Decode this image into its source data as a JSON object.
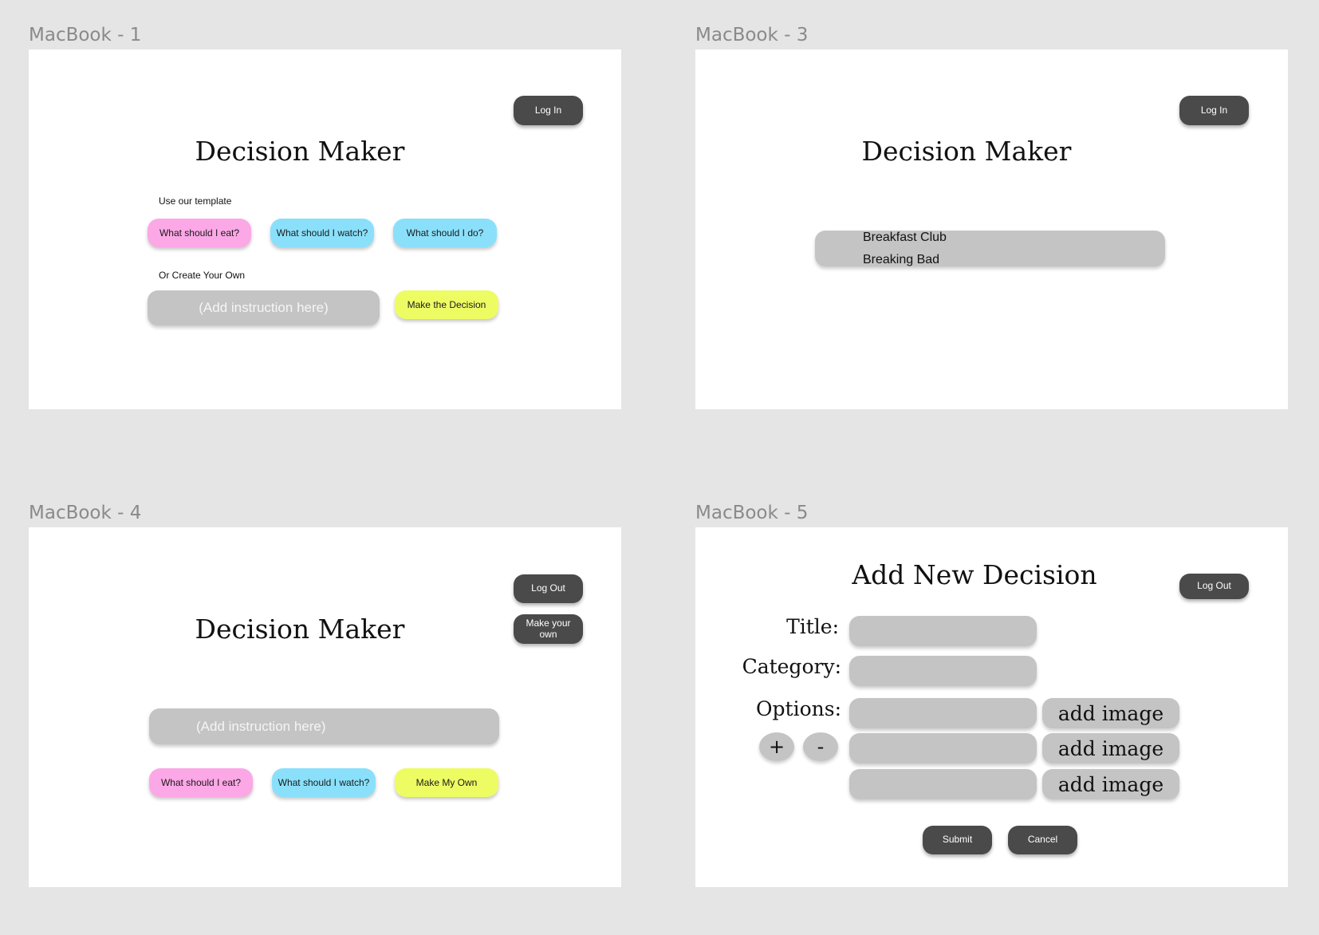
{
  "frames": {
    "f1": {
      "label": "MacBook - 1",
      "login": "Log In",
      "title": "Decision Maker",
      "template_label": "Use our template",
      "templates": [
        "What should I eat?",
        "What should I watch?",
        "What should I do?"
      ],
      "own_label": "Or Create Your Own",
      "instruction_placeholder": "(Add instruction here)",
      "make_decision": "Make the Decision"
    },
    "f3": {
      "label": "MacBook - 3",
      "login": "Log In",
      "title": "Decision Maker",
      "results": [
        "Breakfast Club",
        "Breaking Bad"
      ]
    },
    "f4": {
      "label": "MacBook - 4",
      "logout": "Log Out",
      "make_your_own": "Make your own",
      "title": "Decision Maker",
      "instruction_placeholder": "(Add instruction here)",
      "buttons": [
        "What should I eat?",
        "What should I watch?",
        "Make My Own"
      ]
    },
    "f5": {
      "label": "MacBook - 5",
      "title": "Add New Decision",
      "logout": "Log Out",
      "title_label": "Title:",
      "category_label": "Category:",
      "options_label": "Options:",
      "plus": "+",
      "minus": "-",
      "add_image": "add image",
      "submit": "Submit",
      "cancel": "Cancel"
    }
  },
  "colors": {
    "canvas": "#e5e5e5",
    "dark_button": "#4a4a4a",
    "field_grey": "#c4c4c4",
    "pink": "#fca7e6",
    "cyan": "#8ae0fb",
    "lime": "#eefc64"
  }
}
